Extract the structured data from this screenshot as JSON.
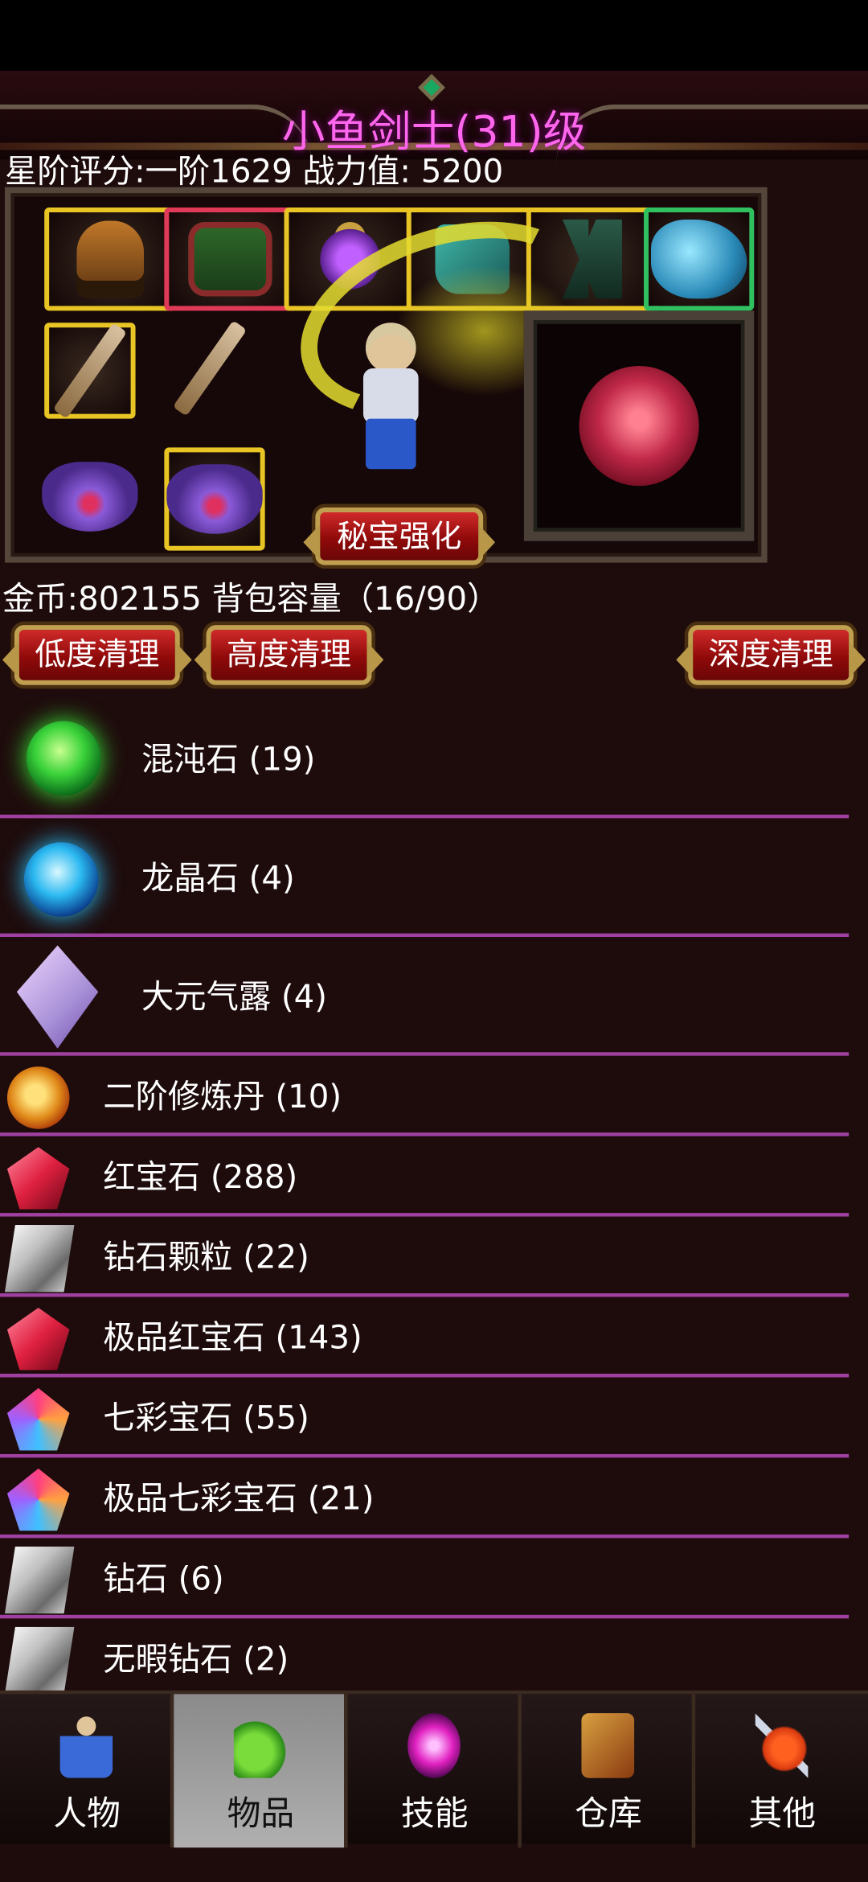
{
  "header": {
    "title": "小鱼剑士(31)级",
    "rating": "星阶评分:一阶1629 战力值: 5200"
  },
  "equipment": {
    "slots": [
      "helmet-icon",
      "armor-icon",
      "amulet-icon",
      "bracer-icon",
      "boots-icon",
      "beast-icon",
      "sword-icon",
      "sword-icon",
      "ring-icon",
      "ring-icon"
    ],
    "treasure_button": "秘宝强化"
  },
  "bag": {
    "gold_line": "金币:802155 背包容量（16/90）",
    "clean_low": "低度清理",
    "clean_high": "高度清理",
    "clean_deep": "深度清理"
  },
  "items": [
    {
      "name": "混沌石 (19)",
      "icon": "green-orb-icon"
    },
    {
      "name": "龙晶石 (4)",
      "icon": "blue-orb-icon"
    },
    {
      "name": "大元气露 (4)",
      "icon": "potion-icon"
    },
    {
      "name": "二阶修炼丹 (10)",
      "icon": "pill-icon"
    },
    {
      "name": "红宝石 (288)",
      "icon": "ruby-icon"
    },
    {
      "name": "钻石颗粒 (22)",
      "icon": "diamond-icon"
    },
    {
      "name": "极品红宝石 (143)",
      "icon": "ruby-icon"
    },
    {
      "name": "七彩宝石 (55)",
      "icon": "rainbow-gem-icon"
    },
    {
      "name": "极品七彩宝石 (21)",
      "icon": "rainbow-gem-icon"
    },
    {
      "name": "钻石 (6)",
      "icon": "diamond-icon"
    },
    {
      "name": "无暇钻石 (2)",
      "icon": "diamond-icon"
    }
  ],
  "nav": {
    "tabs": [
      {
        "label": "人物",
        "icon": "person-icon"
      },
      {
        "label": "物品",
        "icon": "items-icon",
        "active": true
      },
      {
        "label": "技能",
        "icon": "skills-icon"
      },
      {
        "label": "仓库",
        "icon": "warehouse-icon"
      },
      {
        "label": "其他",
        "icon": "other-icon"
      }
    ]
  },
  "colors": {
    "title": "#ff66ee",
    "background": "#1e0b0c",
    "divider": "#a040a0",
    "button_red": "#c01a1a",
    "slot_gold": "#e8c424"
  }
}
